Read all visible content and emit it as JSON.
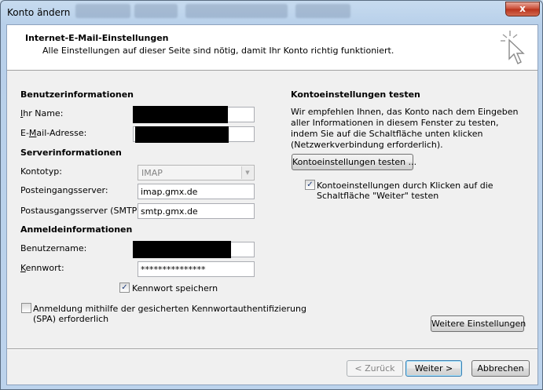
{
  "window": {
    "title": "Konto ändern",
    "close_glyph": "x"
  },
  "header": {
    "title": "Internet-E-Mail-Einstellungen",
    "subtitle": "Alle Einstellungen auf dieser Seite sind nötig, damit Ihr Konto richtig funktioniert."
  },
  "user_info": {
    "section": "Benutzerinformationen",
    "name_label_u": "I",
    "name_label_rest": "hr Name:",
    "email_label_pre": "E-",
    "email_label_u": "M",
    "email_label_rest": "ail-Adresse:"
  },
  "server_info": {
    "section": "Serverinformationen",
    "account_type_label": "Kontotyp:",
    "account_type_value": "IMAP",
    "incoming_label": "Posteingangsserver:",
    "incoming_value": "imap.gmx.de",
    "outgoing_label": "Postausgangsserver (SMTP):",
    "outgoing_value": "smtp.gmx.de"
  },
  "login_info": {
    "section": "Anmeldeinformationen",
    "username_label": "Benutzername:",
    "password_label_u": "K",
    "password_label_rest": "ennwort:",
    "password_value": "***************",
    "remember_label": "Kennwort speichern",
    "remember_checked": true,
    "spa_label_line1": "Anmeldung mithilfe der gesicherten Kennwortauthentifizierung",
    "spa_label_line2": "(SPA) erforderlich",
    "spa_checked": false
  },
  "test": {
    "section": "Kontoeinstellungen testen",
    "description": "Wir empfehlen Ihnen, das Konto nach dem Eingeben aller Informationen in diesem Fenster zu testen, indem Sie auf die Schaltfläche unten klicken (Netzwerkverbindung erforderlich).",
    "test_button": "Kontoeinstellungen testen ...",
    "auto_test_label_line1": "Kontoeinstellungen durch Klicken auf die",
    "auto_test_label_line2": "Schaltfläche \"Weiter\" testen",
    "auto_test_checked": true
  },
  "buttons": {
    "more_settings": "Weitere Einstellungen",
    "back": "< Zurück",
    "next": "Weiter >",
    "cancel": "Abbrechen"
  },
  "icons": {
    "header_icon": "cursor-sparkle-icon"
  }
}
